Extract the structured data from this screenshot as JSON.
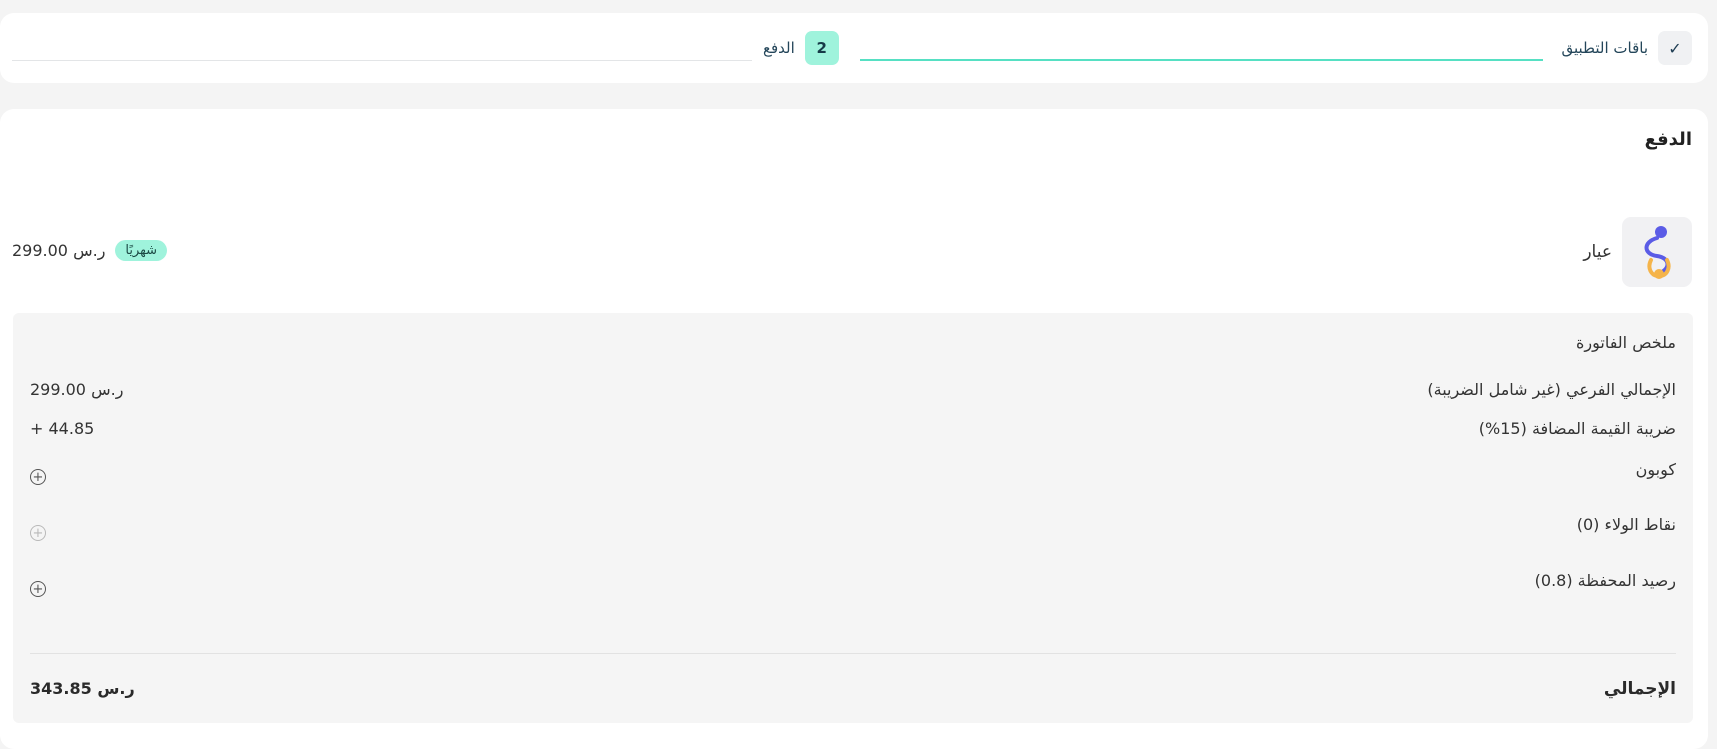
{
  "stepper": {
    "step1_label": "باقات التطبيق",
    "step1_icon": "check-icon",
    "step2_number": "2",
    "step2_label": "الدفع"
  },
  "page": {
    "title": "الدفع"
  },
  "plan": {
    "name": "عيار",
    "logo_icon": "ayar-logo-icon",
    "period": "شهريًا",
    "price": "299.00 ر.س"
  },
  "invoice": {
    "title": "ملخص الفاتورة",
    "subtotal_label": "الإجمالي الفرعي (غير شامل الضريبة)",
    "subtotal_value": "299.00 ر.س",
    "vat_label": "ضريبة القيمة المضافة (15%)",
    "vat_value": "+ 44.85",
    "coupon_label": "كوبون",
    "loyalty_label": "نقاط الولاء (0)",
    "wallet_label": "رصيد المحفظة (0.8)",
    "total_label": "الإجمالي",
    "total_value": "343.85 ر.س"
  },
  "colors": {
    "accent": "#56e0c3",
    "badge_bg": "#9ff3dc",
    "logo_blue": "#5b5ce6",
    "logo_orange": "#f5b44a"
  }
}
